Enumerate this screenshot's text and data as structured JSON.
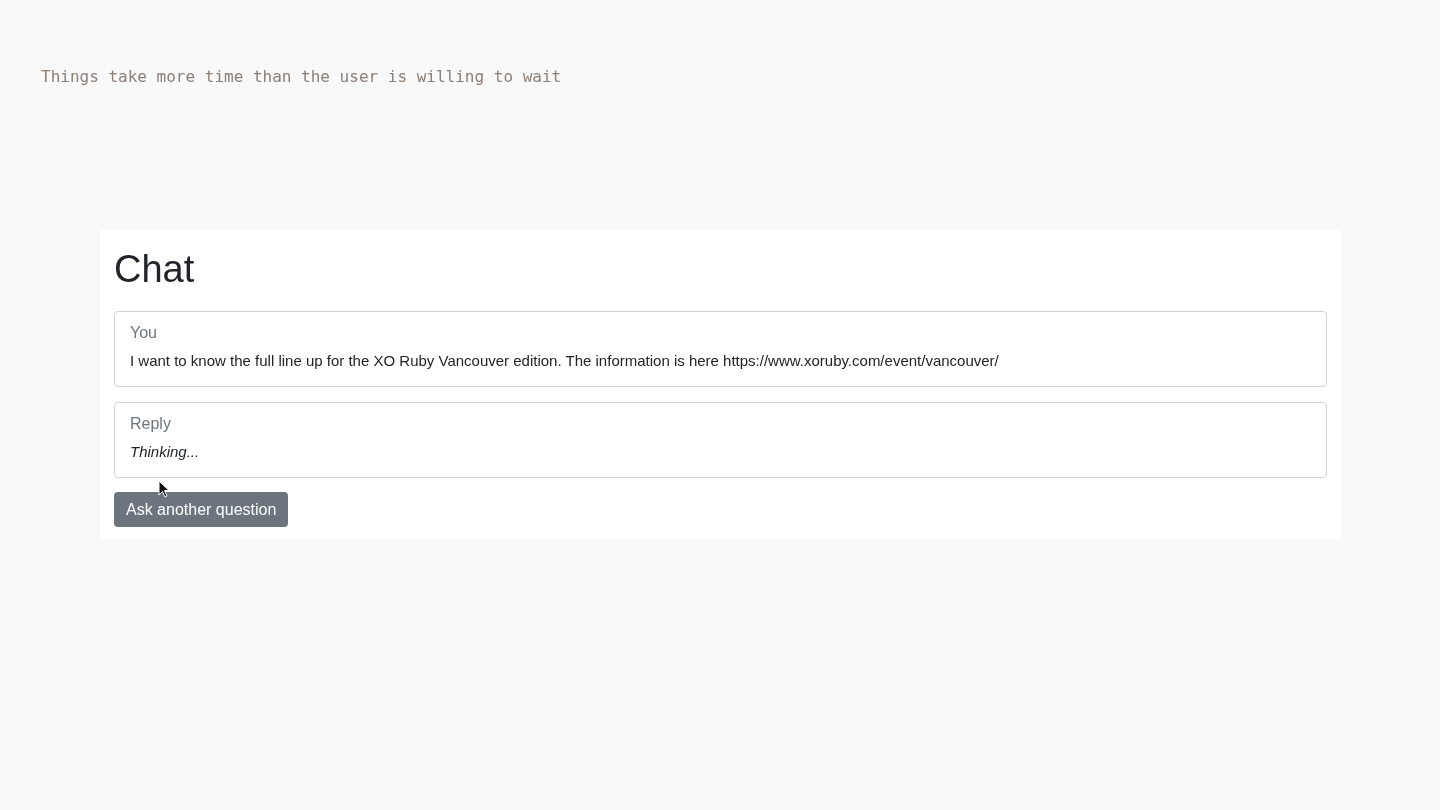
{
  "caption": "Things take more time than the user is willing to wait",
  "chat": {
    "title": "Chat",
    "messages": [
      {
        "label": "You",
        "text": "I want to know the full line up for the XO Ruby Vancouver edition. The information is here https://www.xoruby.com/event/vancouver/",
        "kind": "user"
      },
      {
        "label": "Reply",
        "text": "Thinking...",
        "kind": "pending"
      }
    ],
    "button": "Ask another question"
  }
}
